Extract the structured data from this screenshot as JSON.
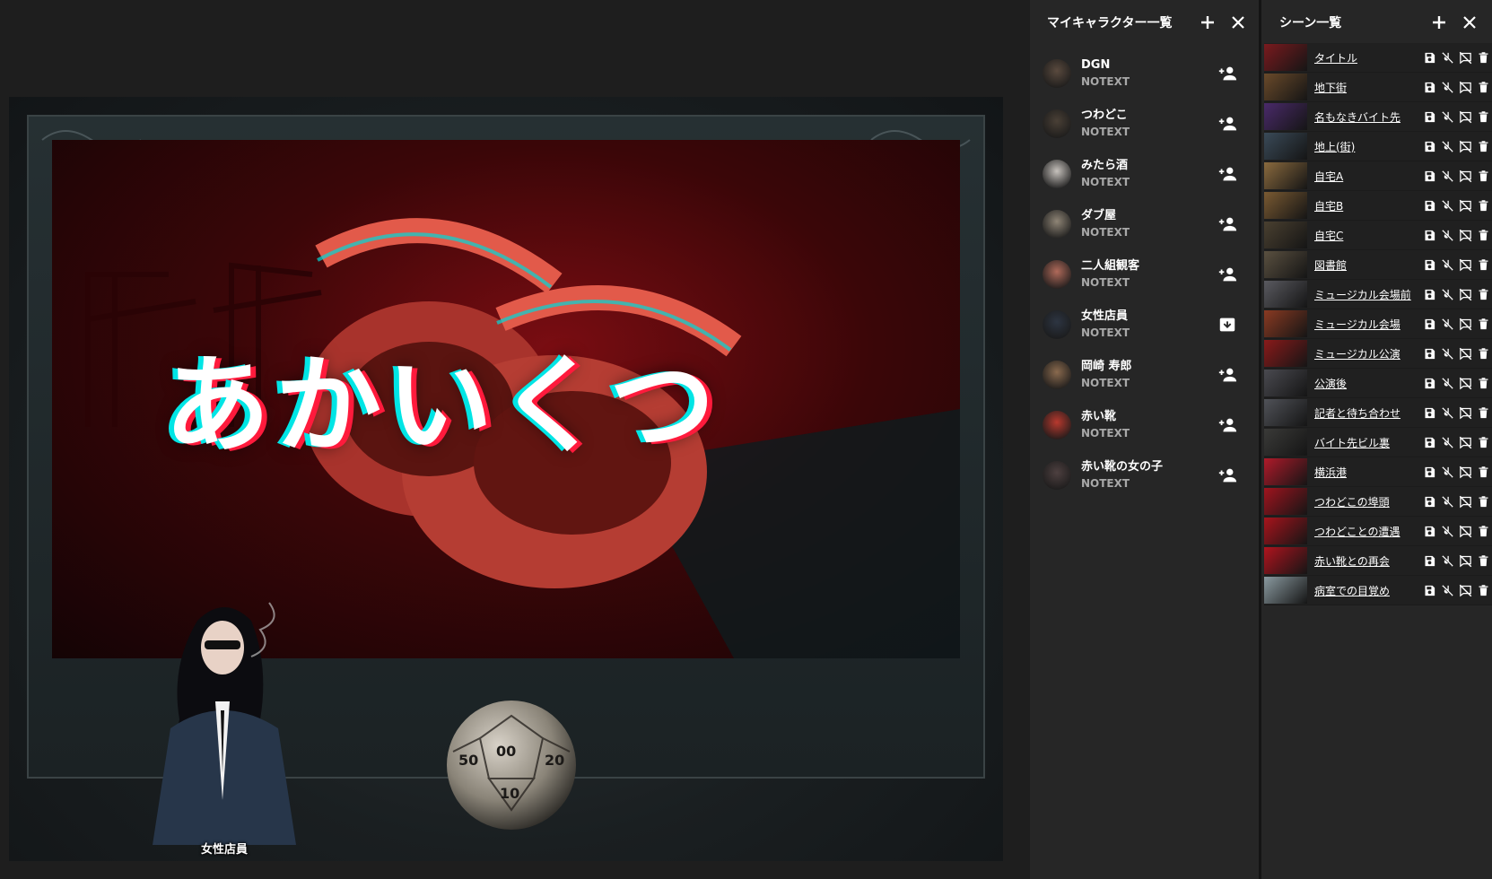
{
  "board": {
    "title_text": "あかいくつ",
    "piece_label": "女性店員"
  },
  "characters": {
    "title": "マイキャラクター一覧",
    "add_icon": "plus-icon",
    "close_icon": "close-icon",
    "items": [
      {
        "name": "DGN",
        "sub": "NOTEXT",
        "action": "person-add-icon",
        "avatar_color": "#5a4a3e"
      },
      {
        "name": "つわどこ",
        "sub": "NOTEXT",
        "action": "person-add-icon",
        "avatar_color": "#4a4036"
      },
      {
        "name": "みたら酒",
        "sub": "NOTEXT",
        "action": "person-add-icon",
        "avatar_color": "#c7c2bd"
      },
      {
        "name": "ダブ屋",
        "sub": "NOTEXT",
        "action": "person-add-icon",
        "avatar_color": "#8f8576"
      },
      {
        "name": "二人組観客",
        "sub": "NOTEXT",
        "action": "person-add-icon",
        "avatar_color": "#b06a5a"
      },
      {
        "name": "女性店員",
        "sub": "NOTEXT",
        "action": "archive-icon",
        "avatar_color": "#2d3542"
      },
      {
        "name": "岡崎 寿郎",
        "sub": "NOTEXT",
        "action": "person-add-icon",
        "avatar_color": "#8a6a4e"
      },
      {
        "name": "赤い靴",
        "sub": "NOTEXT",
        "action": "person-add-icon",
        "avatar_color": "#b8392e"
      },
      {
        "name": "赤い靴の女の子",
        "sub": "NOTEXT",
        "action": "person-add-icon",
        "avatar_color": "#4e4040"
      }
    ]
  },
  "scenes": {
    "title": "シーン一覧",
    "add_icon": "plus-icon",
    "close_icon": "close-icon",
    "row_actions": [
      "save-icon",
      "music-off-icon",
      "comment-off-icon",
      "delete-icon"
    ],
    "items": [
      {
        "name": "タイトル",
        "thumb": "#7a1a1e"
      },
      {
        "name": "地下街",
        "thumb": "#6a4a2a"
      },
      {
        "name": "名もなきバイト先",
        "thumb": "#4a2a6a"
      },
      {
        "name": "地上(街)",
        "thumb": "#3a4a58"
      },
      {
        "name": "自宅A",
        "thumb": "#8a6a3e"
      },
      {
        "name": "自宅B",
        "thumb": "#7a5a32"
      },
      {
        "name": "自宅C",
        "thumb": "#4a4030"
      },
      {
        "name": "図書館",
        "thumb": "#5a5040"
      },
      {
        "name": "ミュージカル会場前",
        "thumb": "#5a5a60"
      },
      {
        "name": "ミュージカル会場",
        "thumb": "#8a3a22"
      },
      {
        "name": "ミュージカル公演",
        "thumb": "#8a1a1a"
      },
      {
        "name": "公演後",
        "thumb": "#4a4a50"
      },
      {
        "name": "記者と待ち合わせ",
        "thumb": "#505258"
      },
      {
        "name": "バイト先ビル裏",
        "thumb": "#3a3a38"
      },
      {
        "name": "横浜港",
        "thumb": "#b01a2a"
      },
      {
        "name": "つわどこの埠頭",
        "thumb": "#a0141e"
      },
      {
        "name": "つわどことの遭遇",
        "thumb": "#a8141c"
      },
      {
        "name": "赤い靴との再会",
        "thumb": "#b0141e"
      },
      {
        "name": "病室での目覚め",
        "thumb": "#8a9aa0"
      }
    ]
  },
  "colors": {
    "panel_bg": "#262626",
    "page_bg": "#1e1e1e",
    "accent_red": "#ff1a3c",
    "accent_cyan": "#00e5e5"
  }
}
